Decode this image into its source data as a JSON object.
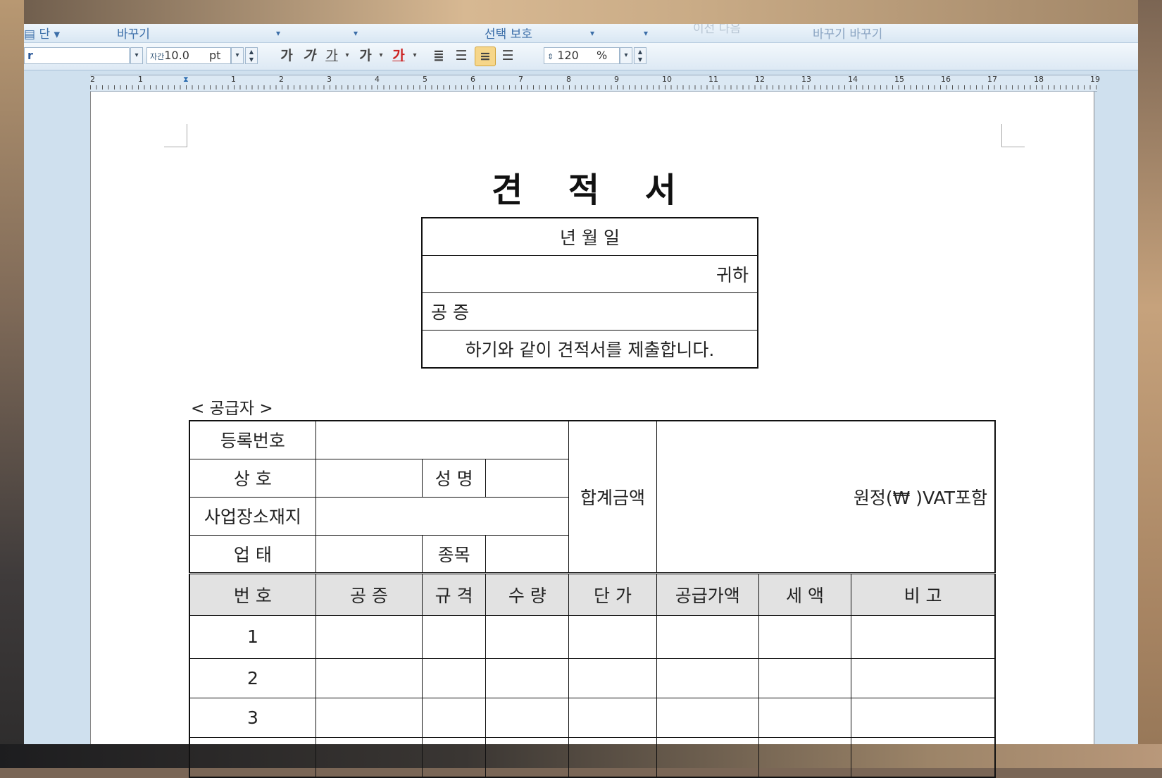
{
  "toolbar_top": {
    "column": "단",
    "replace1": "바꾸기",
    "select_protect": "선택  보호",
    "prev_next": "이전  다음",
    "replace2": "바꾸기  바꾸기"
  },
  "toolbar": {
    "font_name": "r",
    "font_size_icon": "자간",
    "font_size": "10.0",
    "font_unit": "pt",
    "bold": "가",
    "italic": "가",
    "underline": "가",
    "strike": "가",
    "font_color": "가",
    "line_spacing": "120",
    "line_spacing_unit": "%"
  },
  "ruler": {
    "labels": [
      "2",
      "1",
      "",
      "1",
      "2",
      "3",
      "4",
      "5",
      "6",
      "7",
      "8",
      "9",
      "10",
      "11",
      "12",
      "13",
      "14",
      "15",
      "16",
      "17",
      "18",
      "19"
    ]
  },
  "document": {
    "title": "견 적 서",
    "date_row": "년        월        일",
    "recipient": "귀하",
    "work_type": "공 증",
    "submit_text": "하기와 같이 견적서를 제출합니다.",
    "supplier_label": "< 공급자 >",
    "reg_no": "등록번호",
    "company": "상      호",
    "name": "성 명",
    "address": "사업장소재지",
    "business": "업      태",
    "item": "종목",
    "total_label": "합계금액",
    "total_value": "원정(₩              )VAT포함",
    "headers": [
      "번 호",
      "공 증",
      "규 격",
      "수 량",
      "단 가",
      "공급가액",
      "세 액",
      "비 고"
    ],
    "rows": [
      "1",
      "2",
      "3"
    ]
  }
}
